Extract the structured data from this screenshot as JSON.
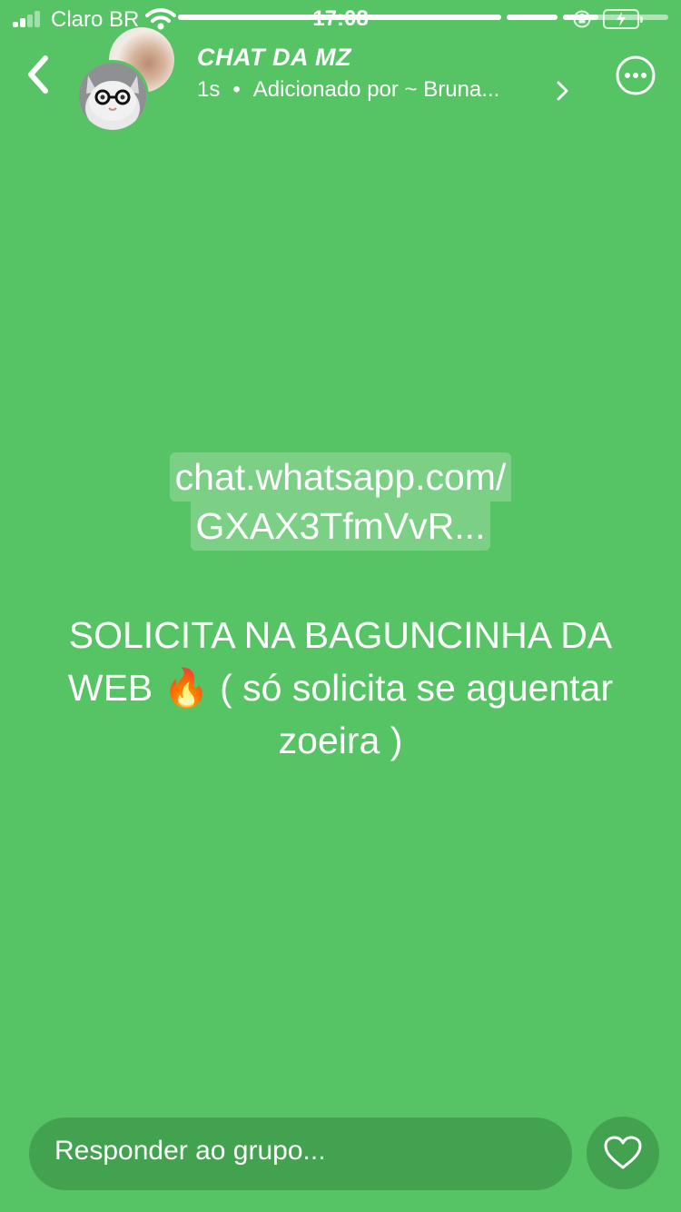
{
  "status_bar": {
    "carrier": "Claro BR",
    "time": "17:08",
    "signal_bars_filled": 2,
    "signal_bars_total": 4
  },
  "story_progress": [
    {
      "fraction": 1.0
    },
    {
      "fraction": 1.0
    },
    {
      "fraction": 0.34
    }
  ],
  "header": {
    "title": "CHAT DA MZ",
    "time_ago": "1s",
    "separator": "•",
    "added_by": "Adicionado por ~ Bruna..."
  },
  "status_content": {
    "link_line1": "chat.whatsapp.com/",
    "link_line2": "GXAX3TfmVvR...",
    "caption": "SOLICITA NA BAGUNCINHA DA WEB 🔥 ( só solicita se aguentar zoeira )"
  },
  "footer": {
    "reply_placeholder": "Responder ao grupo..."
  },
  "colors": {
    "background": "#56c364",
    "input_bg": "#43a24f"
  },
  "icons": {
    "back": "chevron-left-icon",
    "more": "more-options-icon",
    "chevron": "chevron-right-icon",
    "heart": "heart-icon"
  }
}
